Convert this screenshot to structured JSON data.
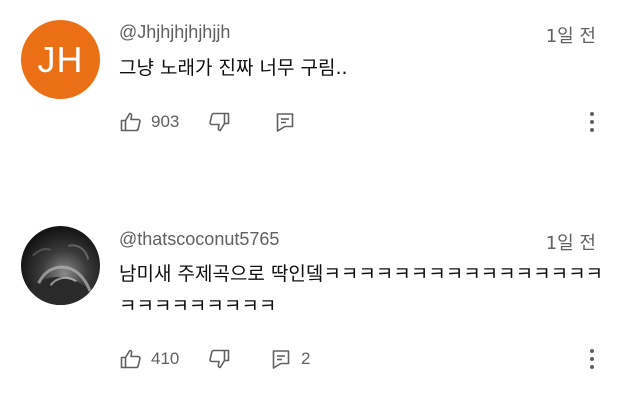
{
  "comments": [
    {
      "avatar_text": "JH",
      "avatar_color": "#ea6f15",
      "author": "@Jhjhjhjhjhjjh",
      "time": "1일 전",
      "text": "그냥 노래가 진짜 너무 구림..",
      "likes": "903",
      "replies": ""
    },
    {
      "avatar_text": "",
      "author": "@thatscoconut5765",
      "time": "1일 전",
      "text": "남미새 주제곡으로 딱인뎈ㅋㅋㅋㅋㅋㅋㅋㅋㅋㅋㅋㅋㅋㅋㅋㅋㅋㅋㅋㅋㅋㅋㅋㅋㅋ",
      "likes": "410",
      "replies": "2"
    }
  ],
  "icons": {
    "like": "thumbs-up-icon",
    "dislike": "thumbs-down-icon",
    "reply": "reply-icon",
    "more": "more-vertical-icon"
  }
}
